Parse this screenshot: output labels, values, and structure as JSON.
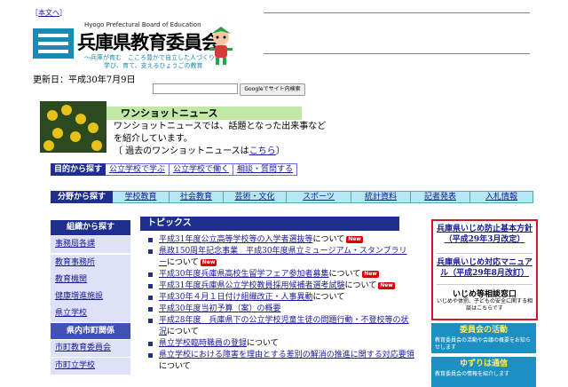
{
  "skip_link": "本文へ",
  "header": {
    "org_en": "Hyogo Prefectural Board of Education",
    "org_jp": "兵庫県教育委員会",
    "tagline1": "〜兵庫が育む　こころ豊かで自立した人づくり〜",
    "tagline2": "学び、育て、支えるひょうごの教育"
  },
  "updated": "更新日：平成30年7月9日",
  "search": {
    "button": "Googleでサイト内検索"
  },
  "news": {
    "title": "ワンショットニュース",
    "line1": "ワンショットニュースでは、話題となった出来事など",
    "line2": "を紹介しています。",
    "line3_prefix": "〔 過去のワンショットニュースは",
    "line3_link": "こちら",
    "line3_suffix": "〕"
  },
  "purpose_nav": {
    "head": "目的から探す",
    "items": [
      "公立学校で学ぶ",
      "公立学校で働く",
      "相談・質問する"
    ]
  },
  "field_nav": {
    "head": "分野から探す",
    "items": [
      "学校教育",
      "社会教育",
      "芸術・文化",
      "スポーツ",
      "統計資料",
      "記者発表",
      "入札情報"
    ]
  },
  "sidebar": {
    "head": "組織から探す",
    "items1": [
      "事務局各課",
      "教育事務所",
      "教育機関",
      "健康増進施設",
      "県立学校"
    ],
    "sub": "県内市町関係",
    "items2": [
      "市町教育委員会",
      "市町立学校"
    ]
  },
  "topics": {
    "head": "トピックス",
    "new_label": "New",
    "items": [
      {
        "link": "平成31年度公立高等学校等の入学者選抜等",
        "suffix": "について",
        "new": true
      },
      {
        "link": "県政150周年記念事業　平成30年度県立ミュージアム・スタンプラリー",
        "suffix": "について",
        "new": true
      },
      {
        "link": "平成30年度兵庫県高校生留学フェア参加者募集",
        "suffix": "について",
        "new": true
      },
      {
        "link": "平成31年度兵庫県公立学校教員採用候補者選考試験",
        "suffix": "について",
        "new": true
      },
      {
        "link": "平成30年４月１日付け組織改正・人事異動",
        "suffix": "について",
        "new": false
      },
      {
        "link": "平成30年度当初予算（案）の概要",
        "suffix": "",
        "new": false
      },
      {
        "link": "平成28年度　兵庫県下の公立学校児童生徒の問題行動・不登校等の状況",
        "suffix": "について",
        "new": false
      },
      {
        "link": "県立学校臨時職員の登録",
        "suffix": "について",
        "new": false
      },
      {
        "link": "県立学校における障害を理由とする差別の解消の推進に関する対応要領",
        "suffix": "について",
        "new": false
      }
    ]
  },
  "right": {
    "bully1": "兵庫県いじめ防止基本方針（平成29年3月改定）",
    "bully2": "兵庫県いじめ対応マニュアル（平成29年8月改訂）",
    "bully3": "いじめ等相談窓口",
    "bully4": "いじめや体罰、子どもの安全に関する相談はこちらです",
    "box1_title": "委員会の活動",
    "box1_desc": "教育委員会の活動や会議の概要をお知らせします",
    "box2_title": "ゆずりは通信",
    "box2_desc": "教育委員会の情報を紹介します"
  },
  "colors": {
    "navy": "#1e2f8f",
    "link": "#1a1a99",
    "accent_red": "#cc1a2a",
    "sky": "#1d8fc3"
  }
}
